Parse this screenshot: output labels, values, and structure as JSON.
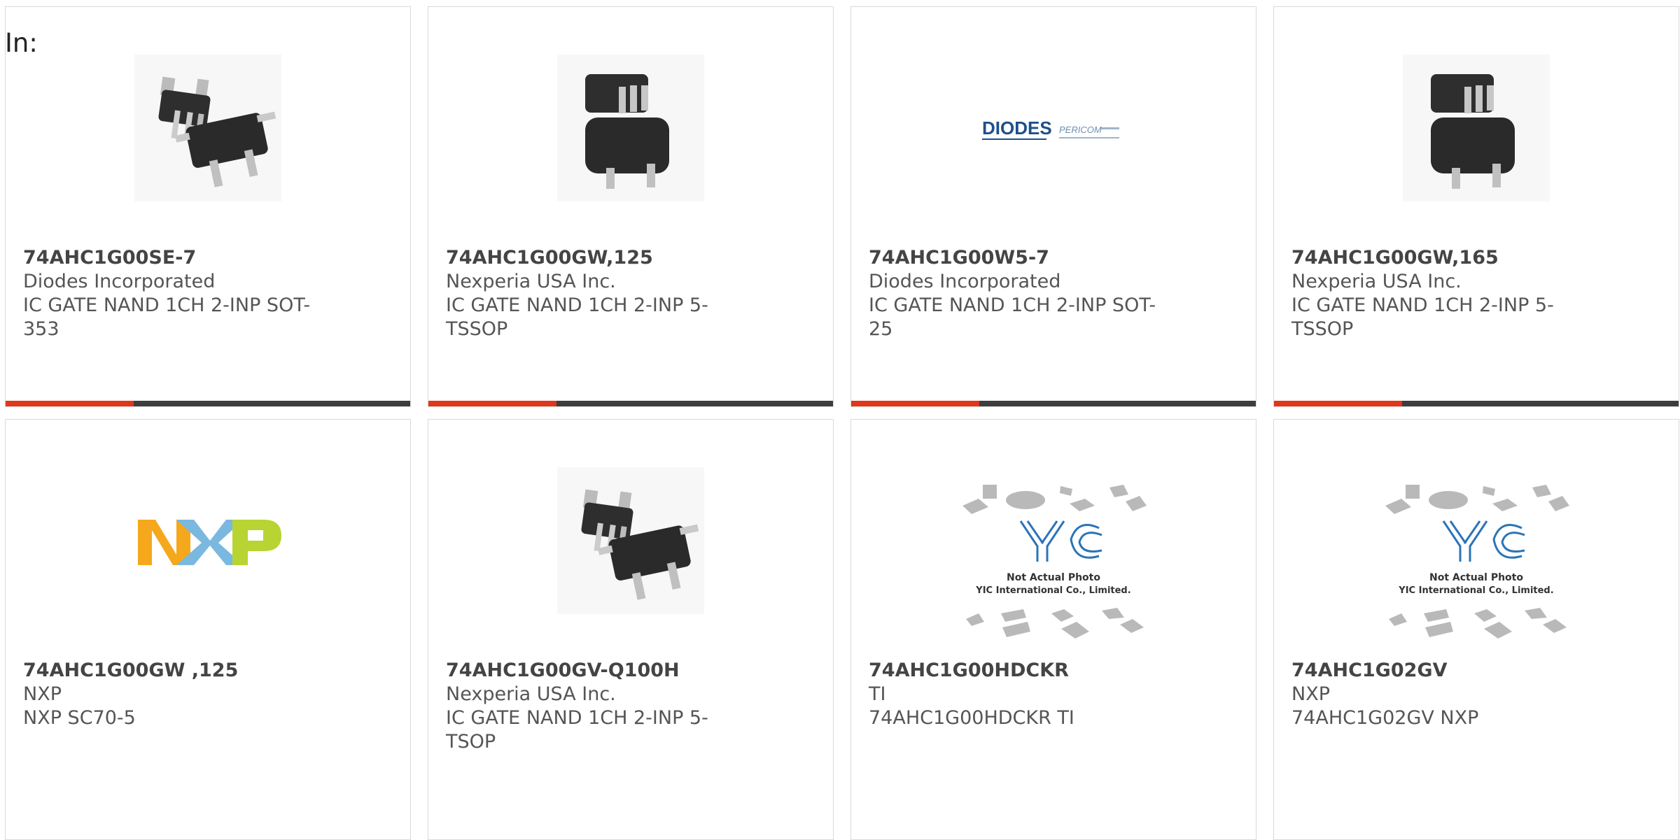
{
  "header": {
    "in_label": "In:"
  },
  "colors": {
    "accent": "#e2361a",
    "bar": "#3d3d3d",
    "text": "#555555"
  },
  "products": [
    {
      "part": "74AHC1G00SE-7",
      "manufacturer": "Diodes Incorporated",
      "description": "IC GATE NAND 1CH 2-INP SOT-353",
      "image": "sot-chip-photo"
    },
    {
      "part": "74AHC1G00GW,125",
      "manufacturer": "Nexperia USA Inc.",
      "description": "IC GATE NAND 1CH 2-INP 5-TSSOP",
      "image": "sot-chip-photo"
    },
    {
      "part": "74AHC1G00W5-7",
      "manufacturer": "Diodes Incorporated",
      "description": "IC GATE NAND 1CH 2-INP SOT-25",
      "image": "diodes-pericom-logo",
      "logo_text_1": "DIODES",
      "logo_text_2": "PERICOM"
    },
    {
      "part": "74AHC1G00GW,165",
      "manufacturer": "Nexperia USA Inc.",
      "description": "IC GATE NAND 1CH 2-INP 5-TSSOP",
      "image": "sot-chip-photo"
    },
    {
      "part": "74AHC1G00GW ,125",
      "manufacturer": "NXP",
      "description": "NXP SC70-5",
      "image": "nxp-logo",
      "logo_text": "NXP"
    },
    {
      "part": "74AHC1G00GV-Q100H",
      "manufacturer": "Nexperia USA Inc.",
      "description": "IC GATE NAND 1CH 2-INP 5-TSOP",
      "image": "sot-chip-photo"
    },
    {
      "part": "74AHC1G00HDCKR",
      "manufacturer": "TI",
      "description": "74AHC1G00HDCKR TI",
      "image": "yic-placeholder",
      "placeholder_logo": "YIC",
      "placeholder_line1": "Not Actual Photo",
      "placeholder_line2": "YIC International Co., Limited."
    },
    {
      "part": "74AHC1G02GV",
      "manufacturer": "NXP",
      "description": "74AHC1G02GV NXP",
      "image": "yic-placeholder",
      "placeholder_logo": "YIC",
      "placeholder_line1": "Not Actual Photo",
      "placeholder_line2": "YIC International Co., Limited."
    }
  ]
}
